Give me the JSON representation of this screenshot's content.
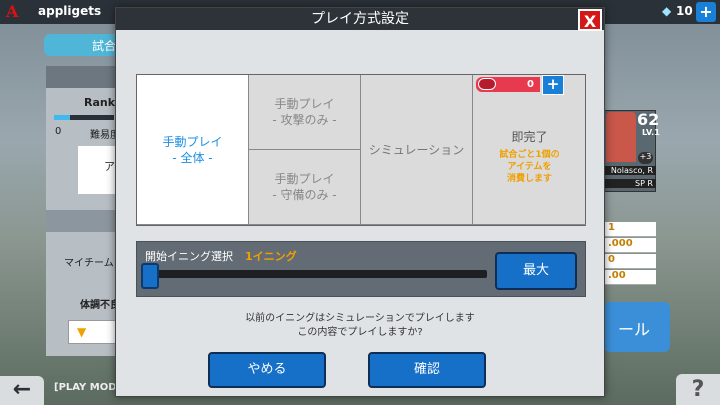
{
  "topbar": {
    "logo": "A",
    "username": "appligets",
    "gem_icon": "diamond-icon",
    "gem_count": "10",
    "plus_label": "+"
  },
  "background": {
    "tab_label": "試合",
    "rank_label": "Rank:",
    "rank_value_start": "0",
    "player_name_partial": "難易度",
    "whitebox_text": "ア",
    "myteam_label": "マイチーム",
    "condition_label": "体調不良",
    "play_mode_label": "[PLAY MODE]",
    "card_number": "62",
    "card_level": "LV.1",
    "card_plus": "+3",
    "card_name": "Nolasco, R",
    "card_position": "SP R",
    "stats": [
      "1",
      ".000",
      "0",
      ".00"
    ],
    "big_button_partial": "ール"
  },
  "modal": {
    "title": "プレイ方式設定",
    "close_label": "X",
    "modes": {
      "manual_all": {
        "line1": "手動プレイ",
        "line2": "- 全体 -"
      },
      "manual_attack": {
        "line1": "手動プレイ",
        "line2": "- 攻撃のみ -"
      },
      "manual_defense": {
        "line1": "手動プレイ",
        "line2": "- 守備のみ -"
      },
      "simulation": {
        "line1": "シミュレーション"
      },
      "quick": {
        "line1": "即完了",
        "note1": "試合ごと1個の",
        "note2": "アイテムを",
        "note3": "消費します"
      }
    },
    "ticket": {
      "count": "0",
      "plus_label": "+"
    },
    "inning": {
      "label": "開始イニング選択",
      "value": "1イニング",
      "slider_value": 1,
      "max_label": "最大"
    },
    "confirm_line1": "以前のイニングはシミュレーションでプレイします",
    "confirm_line2": "この内容でプレイしますか?",
    "cancel_label": "やめる",
    "ok_label": "確認"
  },
  "colors": {
    "accent_blue": "#1670c8",
    "active_text": "#1c8fe6",
    "highlight_orange": "#f0a000",
    "close_red": "#d41818"
  }
}
